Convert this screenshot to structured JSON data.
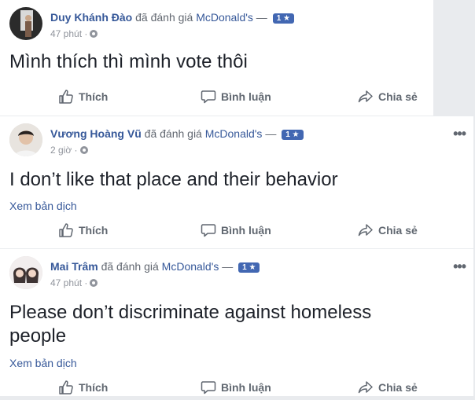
{
  "posts": [
    {
      "author": "Duy Khánh Đào",
      "verb": "đã đánh giá",
      "page": "McDonald's",
      "dash": "—",
      "rating": "1 ★",
      "time": "47 phút ·",
      "text": "Mình thích thì mình vote thôi",
      "translate": "",
      "actions": {
        "like": "Thích",
        "comment": "Bình luận",
        "share": "Chia sẻ"
      }
    },
    {
      "author": "Vương Hoàng Vũ",
      "verb": "đã đánh giá",
      "page": "McDonald's",
      "dash": "—",
      "rating": "1 ★",
      "time": "2 giờ ·",
      "text": "I don’t like that place and their behavior",
      "translate": "Xem bản dịch",
      "more": "•••",
      "actions": {
        "like": "Thích",
        "comment": "Bình luận",
        "share": "Chia sẻ"
      }
    },
    {
      "author": "Mai Trâm",
      "verb": "đã đánh giá",
      "page": "McDonald's",
      "dash": "—",
      "rating": "1 ★",
      "time": "47 phút ·",
      "text_line1": "Please don’t discriminate against homeless",
      "text_line2": "people",
      "translate": "Xem bản dịch",
      "more": "•••",
      "actions": {
        "like": "Thích",
        "comment": "Bình luận",
        "share": "Chia sẻ"
      }
    }
  ],
  "icons": {
    "like": "thumbs-up-icon",
    "comment": "comment-bubble-icon",
    "share": "share-arrow-icon",
    "privacy": "globe-icon"
  },
  "colors": {
    "link": "#365899",
    "rating_badge": "#4267b2",
    "muted": "#90949c"
  }
}
